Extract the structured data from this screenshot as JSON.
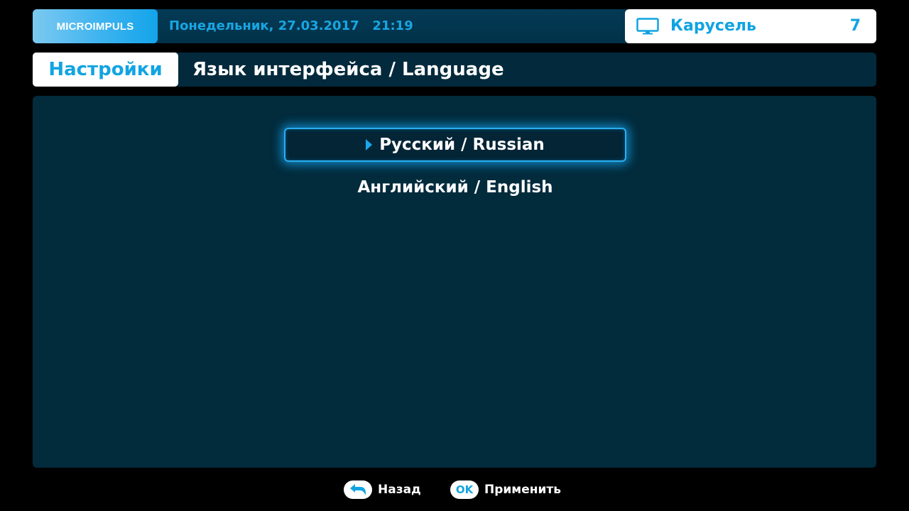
{
  "header": {
    "logo_text": "MICROIMPULS",
    "datetime": "Понедельник, 27.03.2017   21:19",
    "channel": {
      "icon": "tv-icon",
      "name": "Карусель",
      "number": "7"
    }
  },
  "titlebar": {
    "section": "Настройки",
    "title": "Язык интерфейса / Language"
  },
  "language_options": {
    "selected_index": 0,
    "items": [
      {
        "label": "Русский / Russian",
        "selected": true
      },
      {
        "label": "Английский / English",
        "selected": false
      }
    ]
  },
  "footer": {
    "back": {
      "icon": "back-arrow-icon",
      "label": "Назад"
    },
    "ok": {
      "key": "OK",
      "label": "Применить"
    }
  },
  "colors": {
    "accent": "#12a4e2",
    "panel": "#022b3c",
    "background": "#000000",
    "white": "#ffffff"
  }
}
